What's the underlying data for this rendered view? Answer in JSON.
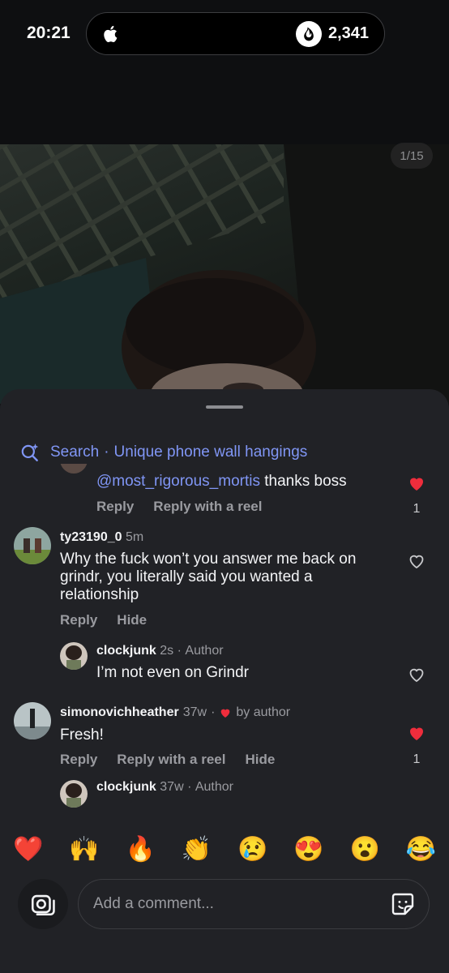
{
  "status": {
    "time": "20:21",
    "island_count": "2,341"
  },
  "photo": {
    "counter": "1/15"
  },
  "search": {
    "label": "Search",
    "query": "Unique phone wall hangings"
  },
  "comments": [
    {
      "mention": "@most_rigorous_mortis",
      "text": " thanks boss",
      "actions": [
        "Reply",
        "Reply with a reel"
      ],
      "likes": "1",
      "liked": true
    },
    {
      "username": "ty23190_0",
      "time": "5m",
      "text": "Why the fuck won’t you answer me back on grindr, you literally said you wanted a relationship",
      "actions": [
        "Reply",
        "Hide"
      ],
      "liked": false,
      "reply": {
        "username": "clockjunk",
        "time": "2s",
        "tag": "Author",
        "text": "I’m not even on Grindr"
      }
    },
    {
      "username": "simonovichheather",
      "time": "37w",
      "badge": "by author",
      "text": "Fresh!",
      "actions": [
        "Reply",
        "Reply with a reel",
        "Hide"
      ],
      "likes": "1",
      "liked": true,
      "reply": {
        "username": "clockjunk",
        "time": "37w",
        "tag": "Author"
      }
    }
  ],
  "emojis": [
    "❤️",
    "🙌",
    "🔥",
    "👏",
    "😢",
    "😍",
    "😮",
    "😂"
  ],
  "composer": {
    "placeholder": "Add a comment..."
  },
  "colors": {
    "accent": "#8096f5",
    "like": "#ef2d3c",
    "sheet": "#212226"
  }
}
